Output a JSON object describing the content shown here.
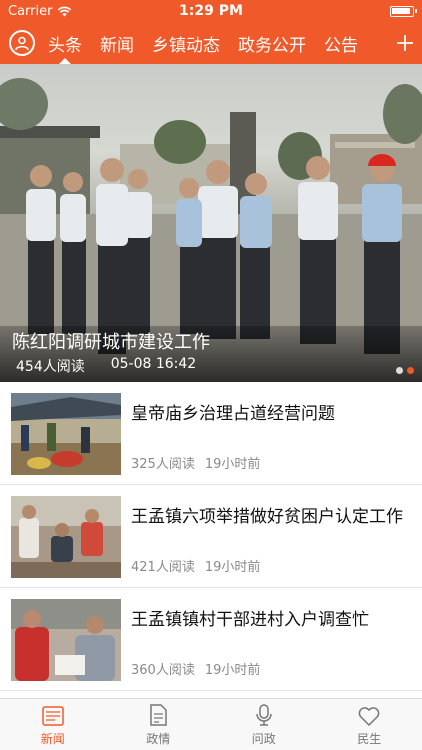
{
  "status": {
    "carrier": "Carrier",
    "time": "1:29 PM"
  },
  "nav": {
    "tabs": [
      "头条",
      "新闻",
      "乡镇动态",
      "政务公开",
      "公告"
    ],
    "active_index": 0
  },
  "hero": {
    "title": "陈红阳调研城市建设工作",
    "reads": "454人阅读",
    "time": "05-08 16:42",
    "page_count": 2,
    "active_page": 1
  },
  "articles": [
    {
      "title": "皇帝庙乡治理占道经营问题",
      "reads": "325人阅读",
      "time": "19小时前"
    },
    {
      "title": "王孟镇六项举措做好贫困户认定工作",
      "reads": "421人阅读",
      "time": "19小时前"
    },
    {
      "title": "王孟镇镇村干部进村入户调查忙",
      "reads": "360人阅读",
      "time": "19小时前"
    }
  ],
  "tabbar": {
    "items": [
      {
        "label": "新闻",
        "icon": "news-icon"
      },
      {
        "label": "政情",
        "icon": "document-icon"
      },
      {
        "label": "问政",
        "icon": "microphone-icon"
      },
      {
        "label": "民生",
        "icon": "heart-icon"
      }
    ],
    "active_index": 0
  },
  "colors": {
    "accent": "#f05a2a"
  }
}
